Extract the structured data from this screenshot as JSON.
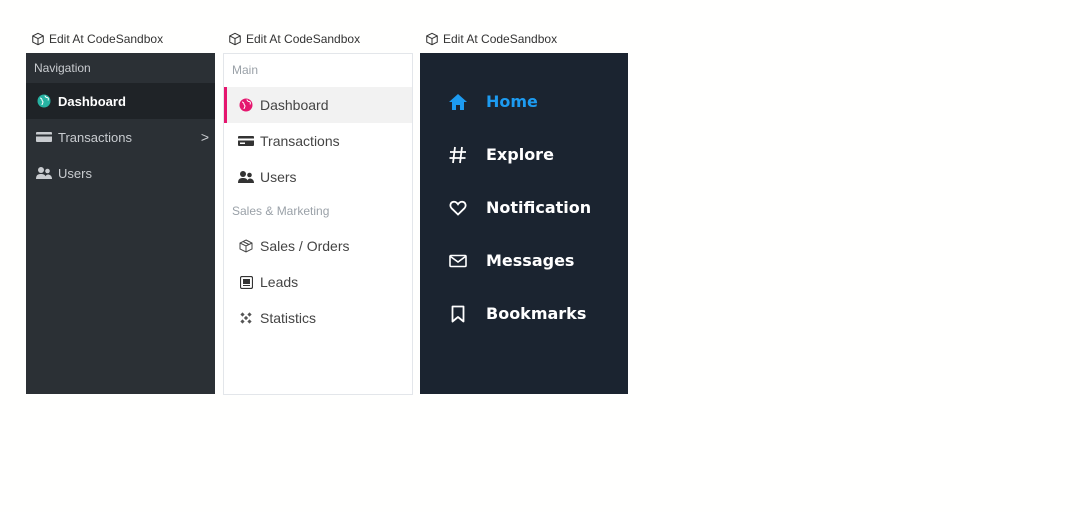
{
  "edit_links": [
    {
      "label": "Edit At CodeSandbox"
    },
    {
      "label": "Edit At CodeSandbox"
    },
    {
      "label": "Edit At CodeSandbox"
    }
  ],
  "panel1": {
    "section_title": "Navigation",
    "items": [
      {
        "label": "Dashboard",
        "icon": "globe-icon",
        "active": true
      },
      {
        "label": "Transactions",
        "icon": "card-icon",
        "has_submenu": true
      },
      {
        "label": "Users",
        "icon": "users-icon"
      }
    ],
    "chevron": ">"
  },
  "panel2": {
    "sections": [
      {
        "title": "Main",
        "items": [
          {
            "label": "Dashboard",
            "icon": "globe-icon",
            "active": true
          },
          {
            "label": "Transactions",
            "icon": "card-icon"
          },
          {
            "label": "Users",
            "icon": "users-icon"
          }
        ]
      },
      {
        "title": "Sales & Marketing",
        "items": [
          {
            "label": "Sales / Orders",
            "icon": "box-icon"
          },
          {
            "label": "Leads",
            "icon": "inbox-icon"
          },
          {
            "label": "Statistics",
            "icon": "sparkle-icon"
          }
        ]
      }
    ]
  },
  "panel3": {
    "items": [
      {
        "label": "Home",
        "icon": "home-icon",
        "active": true
      },
      {
        "label": "Explore",
        "icon": "hashtag-icon"
      },
      {
        "label": "Notification",
        "icon": "heart-icon"
      },
      {
        "label": "Messages",
        "icon": "mail-icon"
      },
      {
        "label": "Bookmarks",
        "icon": "bookmark-icon"
      }
    ]
  },
  "colors": {
    "panel1_bg": "#2b3035",
    "panel2_accent": "#e5176f",
    "panel3_bg": "#1b2430",
    "panel3_active": "#1d9bf0"
  }
}
